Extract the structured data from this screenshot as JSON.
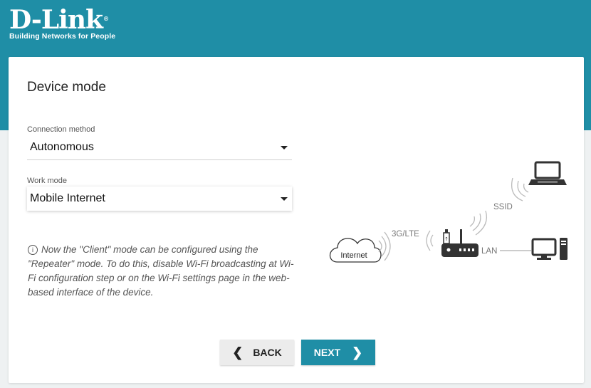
{
  "brand": {
    "logo_text": "D-Link",
    "registered_mark": "®",
    "tagline": "Building Networks for People"
  },
  "page": {
    "title": "Device mode"
  },
  "connection_method": {
    "label": "Connection method",
    "value": "Autonomous"
  },
  "work_mode": {
    "label": "Work mode",
    "value": "Mobile Internet"
  },
  "note": {
    "icon": "info-icon",
    "text": "Now the \"Client\" mode can be configured using the \"Repeater\" mode. To do this, disable Wi-Fi broadcasting at Wi-Fi configuration step or on the Wi-Fi settings page in the web-based interface of the device."
  },
  "diagram": {
    "internet_label": "Internet",
    "mobile_label": "3G/LTE",
    "ssid_label": "SSID",
    "lan_label": "LAN"
  },
  "buttons": {
    "back_label": "BACK",
    "next_label": "NEXT"
  },
  "colors": {
    "accent": "#1f8ea6",
    "background": "#eef1f2"
  }
}
